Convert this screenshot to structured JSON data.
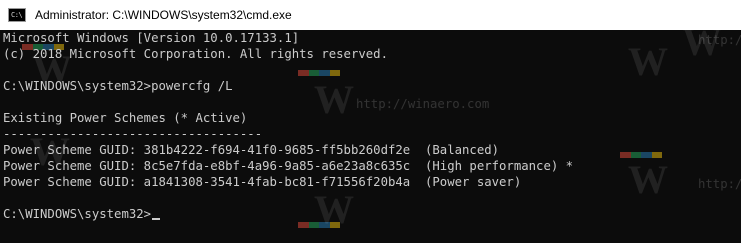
{
  "window": {
    "title": "Administrator: C:\\WINDOWS\\system32\\cmd.exe",
    "icon": "cmd-console-icon",
    "icon_glyph": "C:\\"
  },
  "console": {
    "lines": [
      "Microsoft Windows [Version 10.0.17133.1]",
      "(c) 2018 Microsoft Corporation. All rights reserved.",
      "",
      "C:\\WINDOWS\\system32>powercfg /L",
      "",
      "Existing Power Schemes (* Active)",
      "-----------------------------------",
      "Power Scheme GUID: 381b4222-f694-41f0-9685-ff5bb260df2e  (Balanced)",
      "Power Scheme GUID: 8c5e7fda-e8bf-4a96-9a85-a6e23a8c635c  (High performance) *",
      "Power Scheme GUID: a1841308-3541-4fab-bc81-f71556f20b4a  (Power saver)",
      "",
      "C:\\WINDOWS\\system32>"
    ]
  },
  "watermark": {
    "text": "http://winaero.com",
    "short_text": "http://",
    "letter": "W",
    "colors": [
      "#e74c3c",
      "#27ae60",
      "#2980b9",
      "#f1c40f"
    ]
  },
  "colors": {
    "background": "#0c0c0c",
    "foreground": "#cccccc",
    "titlebar": "#ffffff"
  }
}
